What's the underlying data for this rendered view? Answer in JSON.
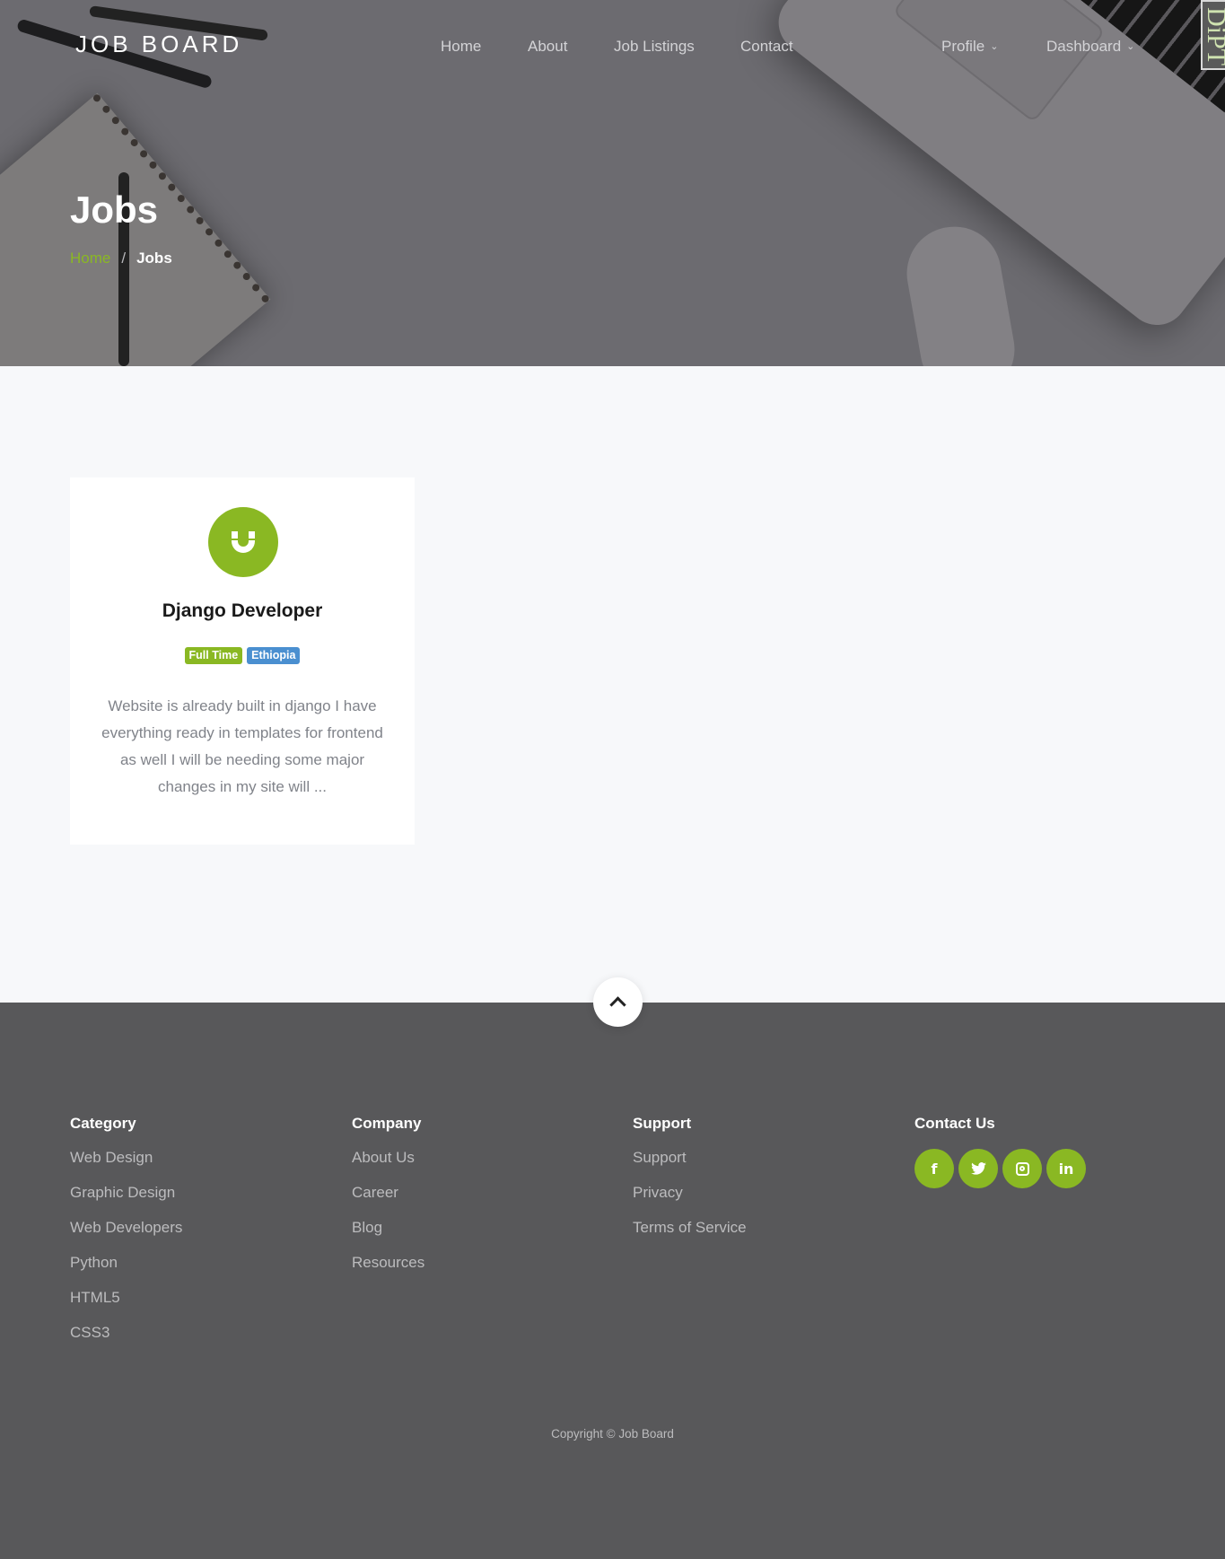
{
  "header": {
    "logo": "JOB BOARD",
    "nav": [
      {
        "label": "Home"
      },
      {
        "label": "About"
      },
      {
        "label": "Job Listings"
      },
      {
        "label": "Contact"
      }
    ],
    "user_nav": [
      {
        "label": "Profile",
        "icon": "chevron-down-icon"
      },
      {
        "label": "Dashboard",
        "icon": "chevron-down-icon"
      }
    ]
  },
  "hero": {
    "title": "Jobs",
    "breadcrumb": {
      "home": "Home",
      "separator": "/",
      "current": "Jobs"
    }
  },
  "jobs": [
    {
      "icon": "magnet-icon",
      "title": "Django Developer",
      "type": "Full Time",
      "location": "Ethiopia",
      "description": "Website is already built in django I have everything ready in templates for frontend as well I will be needing some major changes in my site will ..."
    }
  ],
  "footer": {
    "columns": [
      {
        "title": "Category",
        "links": [
          "Web Design",
          "Graphic Design",
          "Web Developers",
          "Python",
          "HTML5",
          "CSS3"
        ]
      },
      {
        "title": "Company",
        "links": [
          "About Us",
          "Career",
          "Blog",
          "Resources"
        ]
      },
      {
        "title": "Support",
        "links": [
          "Support",
          "Privacy",
          "Terms of Service"
        ]
      }
    ],
    "contact": {
      "title": "Contact Us",
      "social": [
        {
          "icon": "facebook-icon",
          "glyph": "f"
        },
        {
          "icon": "twitter-icon",
          "glyph": ""
        },
        {
          "icon": "instagram-icon",
          "glyph": ""
        },
        {
          "icon": "linkedin-icon",
          "glyph": "in"
        }
      ]
    },
    "copyright": "Copyright © Job Board"
  },
  "colors": {
    "accent": "#8ab823",
    "location_badge": "#4a8fd0",
    "footer_bg": "#58585a",
    "page_bg": "#f7f8fa"
  }
}
